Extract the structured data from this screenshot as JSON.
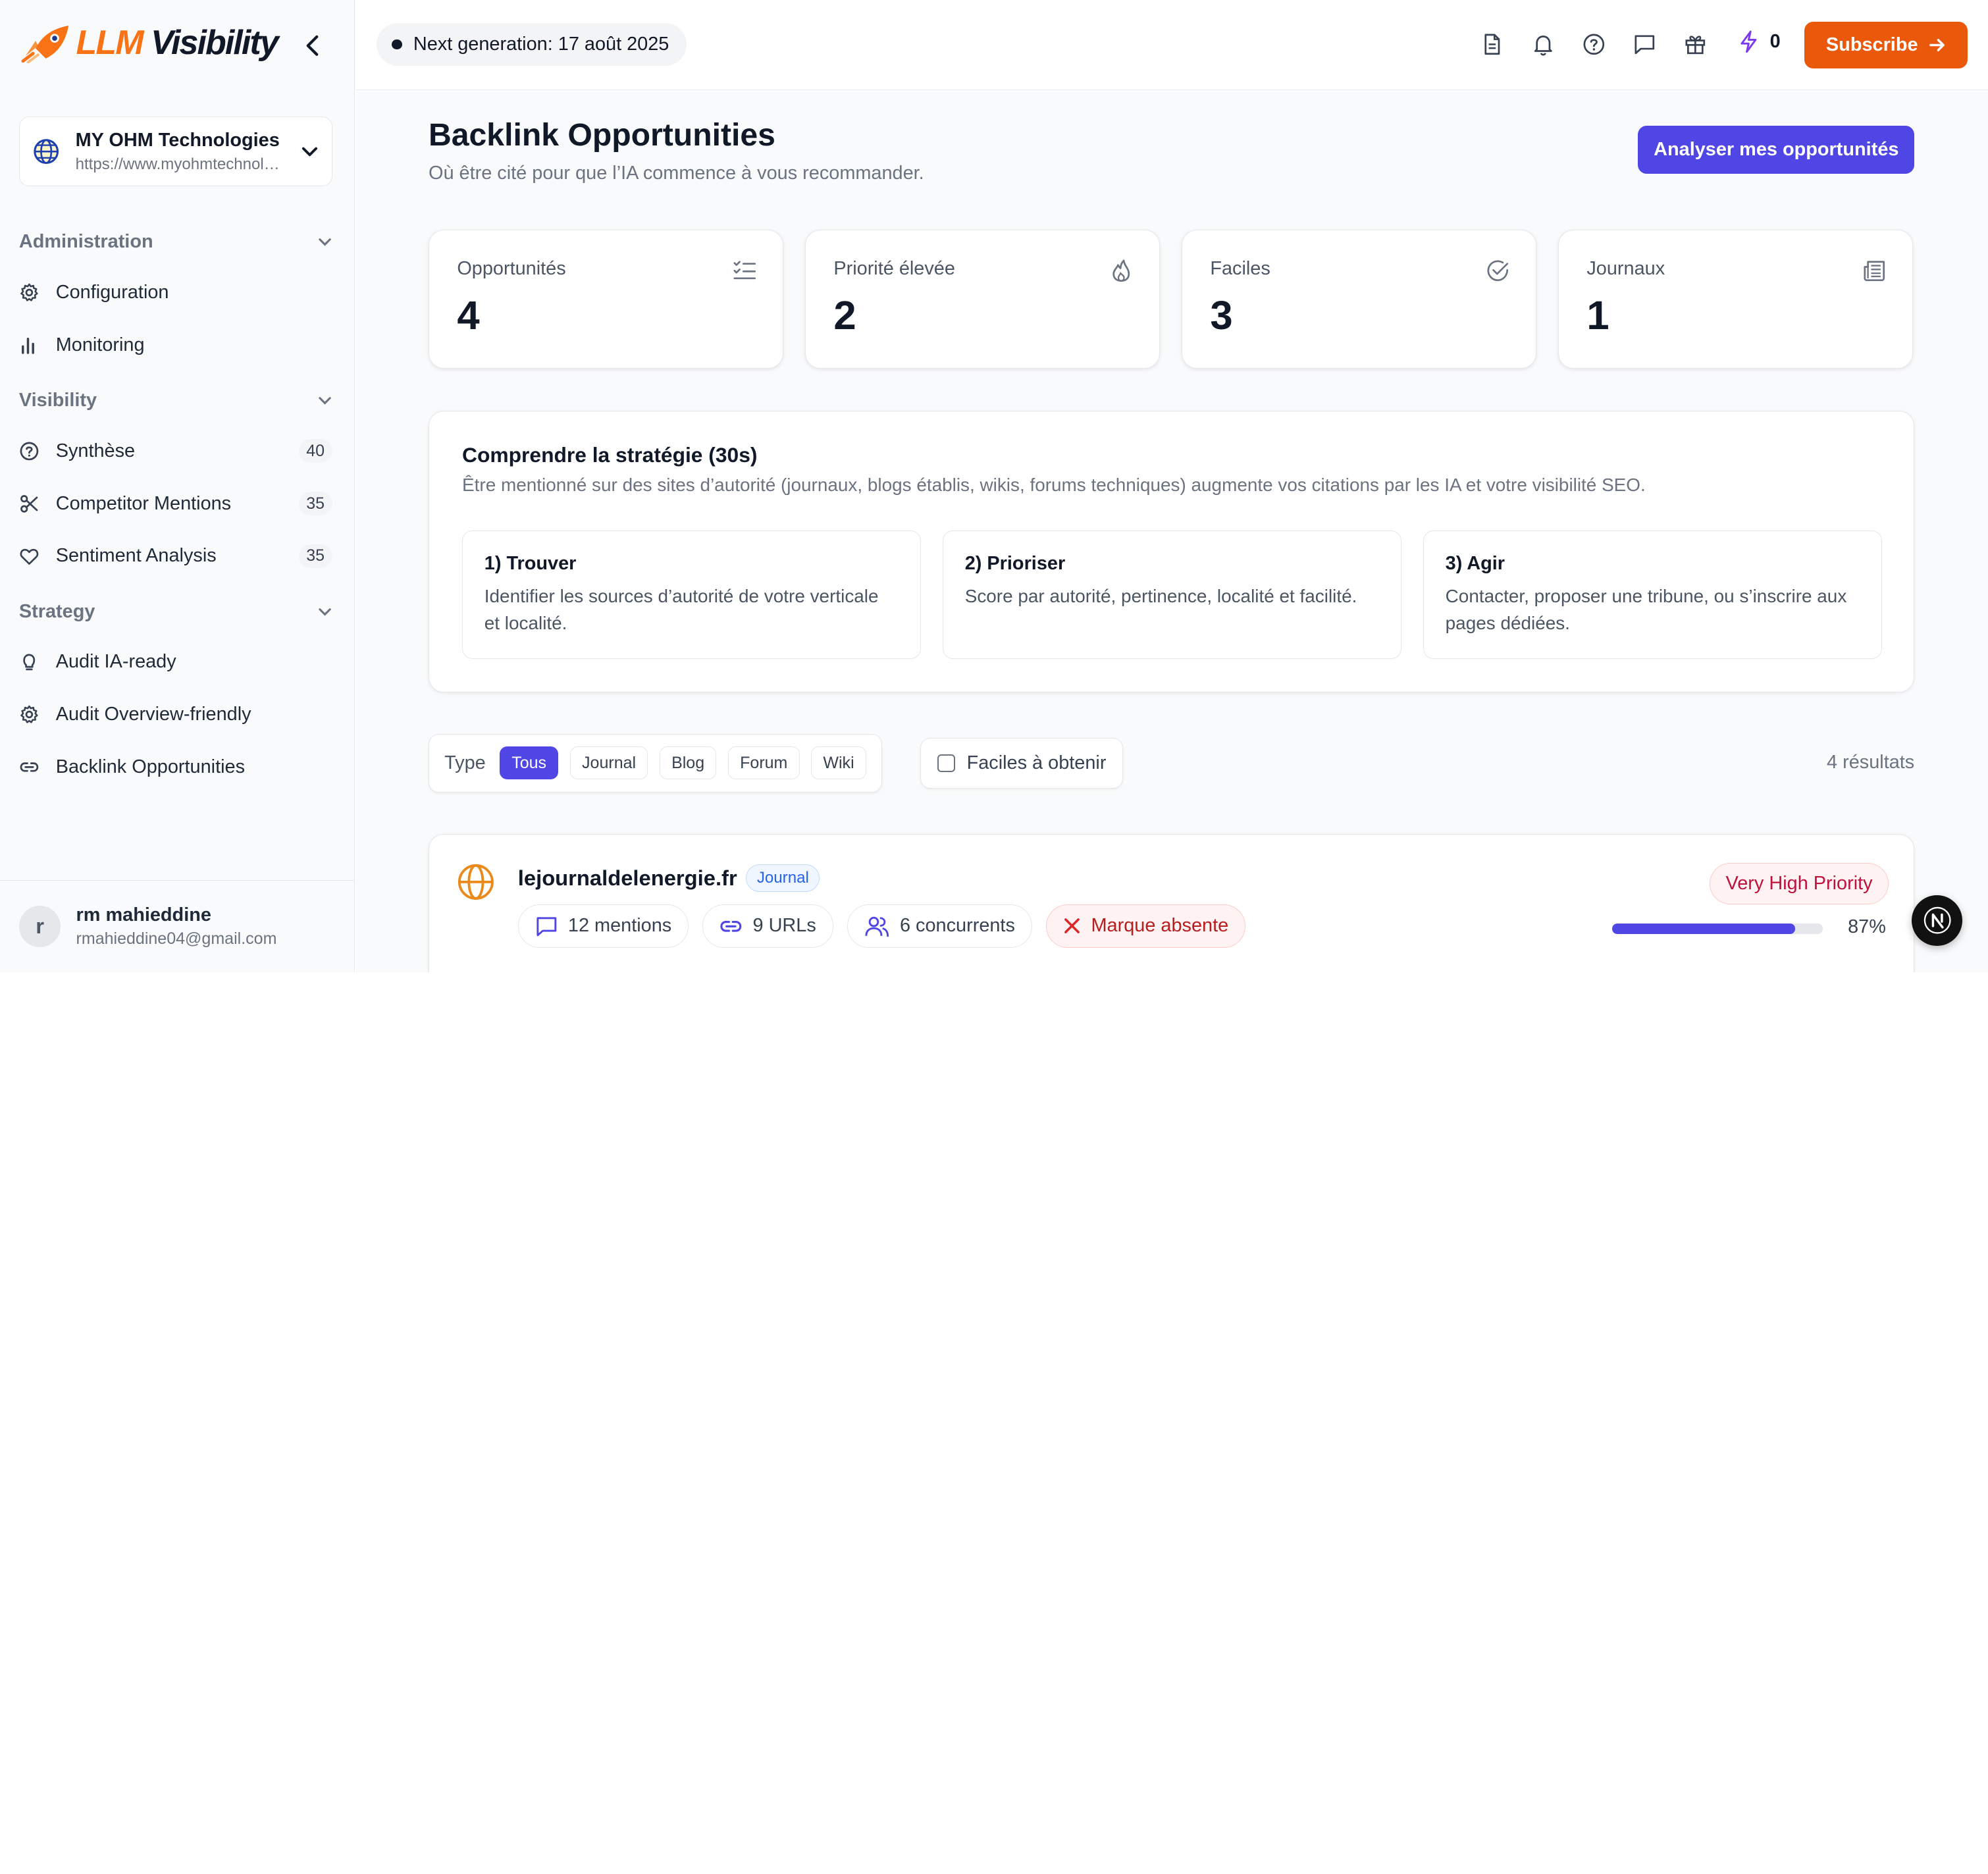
{
  "brand": {
    "logo_prefix": "LLM",
    "logo_suffix": "Visibility",
    "accent": "#f97316"
  },
  "project": {
    "name": "MY OHM Technologies",
    "url": "https://www.myohmtechnologies.com"
  },
  "nav": {
    "administration": {
      "label": "Administration",
      "items": [
        {
          "label": "Configuration",
          "icon": "gear-icon"
        },
        {
          "label": "Monitoring",
          "icon": "bar-chart-icon"
        }
      ]
    },
    "visibility": {
      "label": "Visibility",
      "items": [
        {
          "label": "Synthèse",
          "icon": "help-circle-icon",
          "count": "40"
        },
        {
          "label": "Competitor Mentions",
          "icon": "scissors-icon",
          "count": "35"
        },
        {
          "label": "Sentiment Analysis",
          "icon": "heart-icon",
          "count": "35"
        }
      ]
    },
    "strategy": {
      "label": "Strategy",
      "items": [
        {
          "label": "Audit IA-ready",
          "icon": "lightbulb-icon"
        },
        {
          "label": "Audit Overview-friendly",
          "icon": "gear-icon"
        },
        {
          "label": "Backlink Opportunities",
          "icon": "link-icon"
        }
      ]
    }
  },
  "user": {
    "initial": "r",
    "name": "rm mahieddine",
    "email": "rmahieddine04@gmail.com"
  },
  "header": {
    "next_generation": "Next generation: 17 août 2025",
    "credits": "0",
    "subscribe_label": "Subscribe",
    "subscribe_color": "#ea580c"
  },
  "page": {
    "title": "Backlink Opportunities",
    "subtitle": "Où être cité pour que l’IA commence à vous recommander.",
    "analyse_label": "Analyser mes opportunités"
  },
  "stats": [
    {
      "label": "Opportunités",
      "value": "4",
      "icon": "checklist-icon"
    },
    {
      "label": "Priorité élevée",
      "value": "2",
      "icon": "flame-icon"
    },
    {
      "label": "Faciles",
      "value": "3",
      "icon": "check-circle-icon"
    },
    {
      "label": "Journaux",
      "value": "1",
      "icon": "newspaper-icon"
    }
  ],
  "strategy": {
    "title": "Comprendre la stratégie (30s)",
    "description": "Être mentionné sur des sites d’autorité (journaux, blogs établis, wikis, forums techniques) augmente vos citations par les IA et votre visibilité SEO.",
    "steps": [
      {
        "title": "1) Trouver",
        "desc": "Identifier les sources d’autorité de votre verticale et localité."
      },
      {
        "title": "2) Prioriser",
        "desc": "Score par autorité, pertinence, localité et facilité."
      },
      {
        "title": "3) Agir",
        "desc": "Contacter, proposer une tribune, ou s’inscrire aux pages dédiées."
      }
    ]
  },
  "filters": {
    "type_label": "Type",
    "types": [
      "Tous",
      "Journal",
      "Blog",
      "Forum",
      "Wiki"
    ],
    "active_type": "Tous",
    "easy_label": "Faciles à obtenir",
    "results": "4 résultats"
  },
  "opportunity": {
    "domain": "lejournaldelenergie.fr",
    "type": "Journal",
    "mentions": "12 mentions",
    "urls": "9 URLs",
    "competitors": "6 concurrents",
    "brand_status": "Marque absente",
    "priority": "Very High Priority",
    "score": 0.87,
    "score_text": "87%"
  }
}
